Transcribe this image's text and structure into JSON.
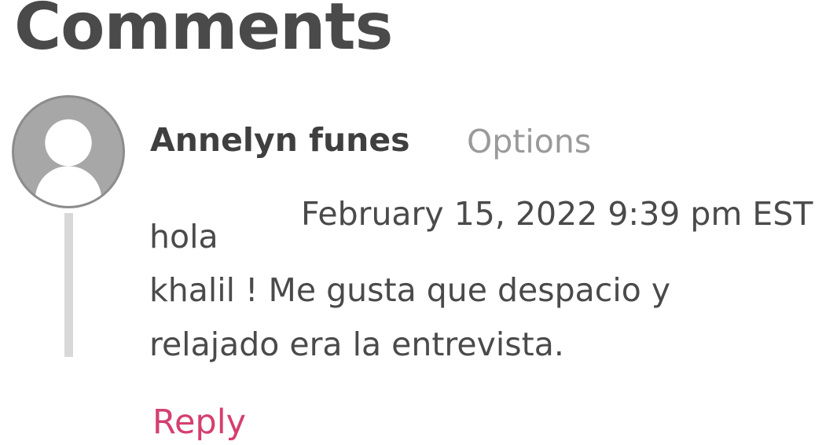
{
  "page": {
    "heading": "Comments"
  },
  "comment": {
    "author": "Annelyn funes",
    "options_label": "Options",
    "timestamp": "February 15, 2022 9:39 pm EST",
    "text_lines": [
      "hola",
      "khalil ! Me gusta que despacio y",
      "relajado era la entrevista."
    ],
    "reply_label": "Reply",
    "avatar_icon": "default-user-avatar-icon"
  },
  "colors": {
    "heading": "#4a4a4a",
    "text": "#4a4a4a",
    "muted": "#9a9a9a",
    "accent": "#d43f6e",
    "avatar_bg": "#a7a7a7",
    "thread_line": "#d8d8d8"
  }
}
